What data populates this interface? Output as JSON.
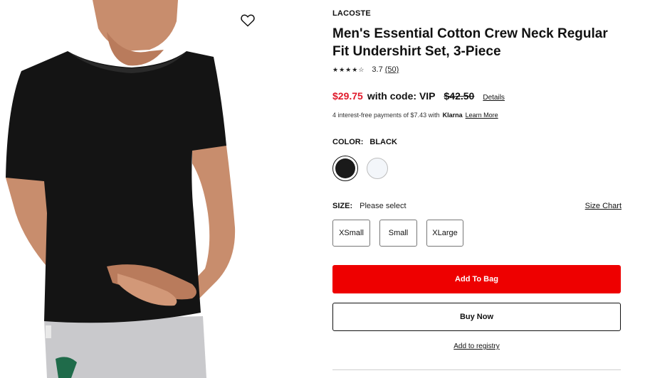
{
  "product": {
    "brand": "LACOSTE",
    "title": "Men's Essential Cotton Crew Neck Regular Fit Undershirt Set, 3-Piece",
    "rating": {
      "stars_filled": 4,
      "stars_total": 5,
      "value": "3.7",
      "count": "(50)"
    },
    "price": {
      "sale": "$29.75",
      "code_text": "with code: VIP",
      "original": "$42.50",
      "details_link": "Details"
    },
    "klarna": {
      "text": "4 interest-free payments of $7.43 with",
      "logo": "Klarna",
      "link": "Learn More"
    },
    "color": {
      "label": "COLOR:",
      "selected": "BLACK",
      "swatches": [
        {
          "name": "black",
          "hex": "#1a1a1a",
          "selected": true
        },
        {
          "name": "white",
          "hex": "#f3f6fa",
          "selected": false
        }
      ]
    },
    "size": {
      "label": "SIZE:",
      "status": "Please select",
      "chart_link": "Size Chart",
      "options": [
        "XSmall",
        "Small",
        "XLarge"
      ]
    },
    "actions": {
      "add_to_bag": "Add To Bag",
      "buy_now": "Buy Now",
      "registry": "Add to registry"
    },
    "colors": {
      "sale": "#e01a2b",
      "add_to_bag_bg": "#ee0000"
    },
    "icons": {
      "wishlist": "heart-outline-icon",
      "rating": "star-icon"
    }
  }
}
